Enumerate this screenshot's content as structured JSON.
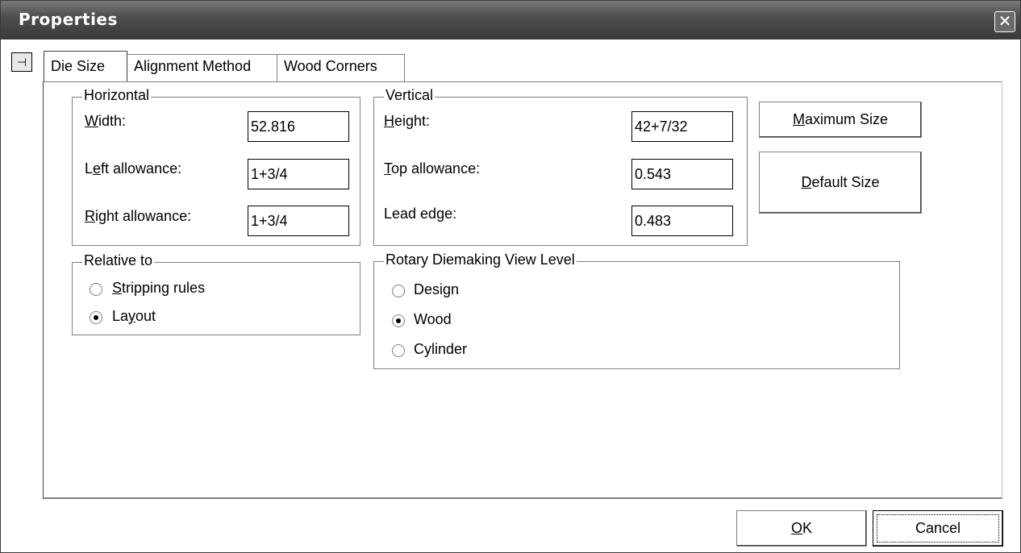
{
  "window": {
    "title": "Properties",
    "close_glyph": "✕"
  },
  "pin_glyph": "⊣",
  "tabs": [
    {
      "label": "Die Size",
      "active": true
    },
    {
      "label": "Alignment Method",
      "active": false
    },
    {
      "label": "Wood Corners",
      "active": false
    }
  ],
  "horizontal": {
    "legend": "Horizontal",
    "width": {
      "label": "Width:",
      "mnemonic": "W",
      "rest": "idth:",
      "value": "52.816"
    },
    "left": {
      "label": "Left allowance:",
      "pre": "L",
      "mnemonic": "e",
      "rest": "ft allowance:",
      "value": "1+3/4"
    },
    "right": {
      "label": "Right allowance:",
      "mnemonic": "R",
      "rest": "ight allowance:",
      "value": "1+3/4"
    }
  },
  "vertical": {
    "legend": "Vertical",
    "height": {
      "label": "Height:",
      "mnemonic": "H",
      "rest": "eight:",
      "value": "42+7/32"
    },
    "top": {
      "label": "Top allowance:",
      "mnemonic": "T",
      "rest": "op allowance:",
      "value": "0.543"
    },
    "lead": {
      "label": "Lead edge:",
      "value": "0.483"
    }
  },
  "buttons": {
    "max": {
      "label": "Maximum Size",
      "mnemonic": "M",
      "rest": "aximum Size"
    },
    "default": {
      "label": "Default Size",
      "mnemonic": "D",
      "rest": "efault Size"
    },
    "ok": {
      "label": "OK",
      "mnemonic": "O",
      "rest": "K"
    },
    "cancel": {
      "label": "Cancel"
    }
  },
  "relative": {
    "legend": "Relative to",
    "stripping": {
      "label": "Stripping rules",
      "mnemonic": "S",
      "rest": "tripping rules",
      "checked": false
    },
    "layout": {
      "label": "Layout",
      "pre": "La",
      "mnemonic": "y",
      "rest": "out",
      "checked": true
    }
  },
  "rotary": {
    "legend": "Rotary Diemaking View Level",
    "design": {
      "label": "Design",
      "checked": false
    },
    "wood": {
      "label": "Wood",
      "checked": true
    },
    "cylinder": {
      "label": "Cylinder",
      "checked": false
    }
  },
  "colors": {
    "titlebar": "#4e4e4e",
    "title_text": "#ffffff",
    "background": "#ffffff"
  }
}
